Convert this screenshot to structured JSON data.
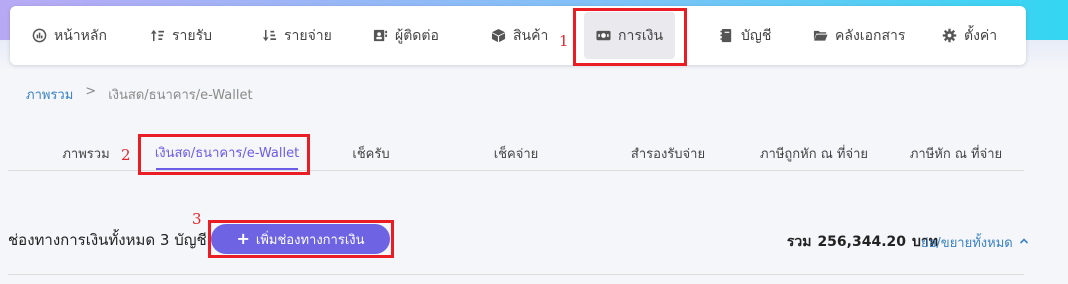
{
  "nav": {
    "items": [
      {
        "label": "หน้าหลัก",
        "icon": "dashboard-icon"
      },
      {
        "label": "รายรับ",
        "icon": "sort-icon"
      },
      {
        "label": "รายจ่าย",
        "icon": "sort-icon"
      },
      {
        "label": "ผู้ติดต่อ",
        "icon": "contacts-icon"
      },
      {
        "label": "สินค้า",
        "icon": "box-icon"
      },
      {
        "label": "การเงิน",
        "icon": "money-icon"
      },
      {
        "label": "บัญชี",
        "icon": "book-icon"
      },
      {
        "label": "คลังเอกสาร",
        "icon": "folder-icon"
      },
      {
        "label": "ตั้งค่า",
        "icon": "gear-icon"
      }
    ],
    "active_index": 5
  },
  "breadcrumb": {
    "root": "ภาพรวม",
    "separator": ">",
    "current": "เงินสด/ธนาคาร/e-Wallet"
  },
  "tabs": [
    {
      "label": "ภาพรวม"
    },
    {
      "label": "เงินสด/ธนาคาร/e-Wallet"
    },
    {
      "label": "เช็ครับ"
    },
    {
      "label": "เช็คจ่าย"
    },
    {
      "label": "สำรองรับจ่าย"
    },
    {
      "label": "ภาษีถูกหัก ณ ที่จ่าย"
    },
    {
      "label": "ภาษีหัก ณ ที่จ่าย"
    }
  ],
  "active_tab_index": 1,
  "channels": {
    "title": "ช่องทางการเงินทั้งหมด 3 บัญชี",
    "add_button": "เพิ่มช่องทางการเงิน",
    "add_icon": "+",
    "total_label": "รวม",
    "total_value": "256,344.20",
    "total_unit": "บาท",
    "toggle_label": "ย่อ/ขยายทั้งหมด"
  },
  "annotations": {
    "callout_1": "1",
    "callout_2": "2",
    "callout_3": "3"
  },
  "colors": {
    "accent": "#6d63e3",
    "link": "#3b82c4",
    "highlight": "#ea1c24"
  }
}
